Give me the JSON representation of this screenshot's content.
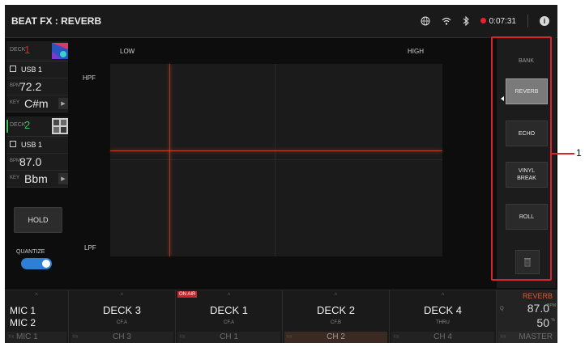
{
  "header": {
    "title": "BEAT FX : REVERB",
    "time": "0:07:31"
  },
  "decks": [
    {
      "tag": "DECK",
      "number": "1",
      "number_color": "#e8212e",
      "source": "USB 1",
      "bpm_label": "BPM",
      "bpm": "72.2",
      "key_label": "KEY",
      "key": "C#m"
    },
    {
      "tag": "DECK",
      "number": "2",
      "number_color": "#3ec45a",
      "source": "USB 1",
      "bpm_label": "BPM",
      "bpm": "87.0",
      "key_label": "KEY",
      "key": "Bbm"
    }
  ],
  "controls": {
    "hold_label": "HOLD",
    "quantize_label": "QUANTIZE",
    "quantize_on": true
  },
  "pad": {
    "low_label": "LOW",
    "high_label": "HIGH",
    "hpf_label": "HPF",
    "lpf_label": "LPF"
  },
  "bank": {
    "title": "BANK",
    "buttons": [
      {
        "label": "REVERB",
        "active": true
      },
      {
        "label": "ECHO",
        "active": false
      },
      {
        "label": "VINYL\nBREAK",
        "active": false
      },
      {
        "label": "ROLL",
        "active": false
      }
    ],
    "trash_icon": "trash-icon"
  },
  "channels": {
    "mic": {
      "mic1": "MIC 1",
      "mic2": "MIC 2",
      "fx_tag": "FX",
      "fx_value": "MIC 1"
    },
    "list": [
      {
        "name": "DECK 3",
        "sub": "CF.A",
        "fx_tag": "FX",
        "fx_value": "CH 3",
        "on_air": ""
      },
      {
        "name": "DECK 1",
        "sub": "CF.A",
        "fx_tag": "FX",
        "fx_value": "CH 1",
        "on_air": "ON AIR"
      },
      {
        "name": "DECK 2",
        "sub": "CF.B",
        "fx_tag": "FX",
        "fx_value": "CH 2",
        "on_air": ""
      },
      {
        "name": "DECK 4",
        "sub": "THRU",
        "fx_tag": "FX",
        "fx_value": "CH 4",
        "on_air": ""
      }
    ]
  },
  "master": {
    "fx_name": "REVERB",
    "q_label": "Q",
    "value1": "87.0",
    "unit1": "BPM",
    "value2": "50",
    "unit2": "%",
    "fx_tag": "FX",
    "fx_value": "MASTER"
  },
  "callout": {
    "number": "1"
  },
  "colors": {
    "accent_red": "#d6262b",
    "fx_orange": "#e05a2c",
    "toggle_blue": "#2e7fd6"
  }
}
